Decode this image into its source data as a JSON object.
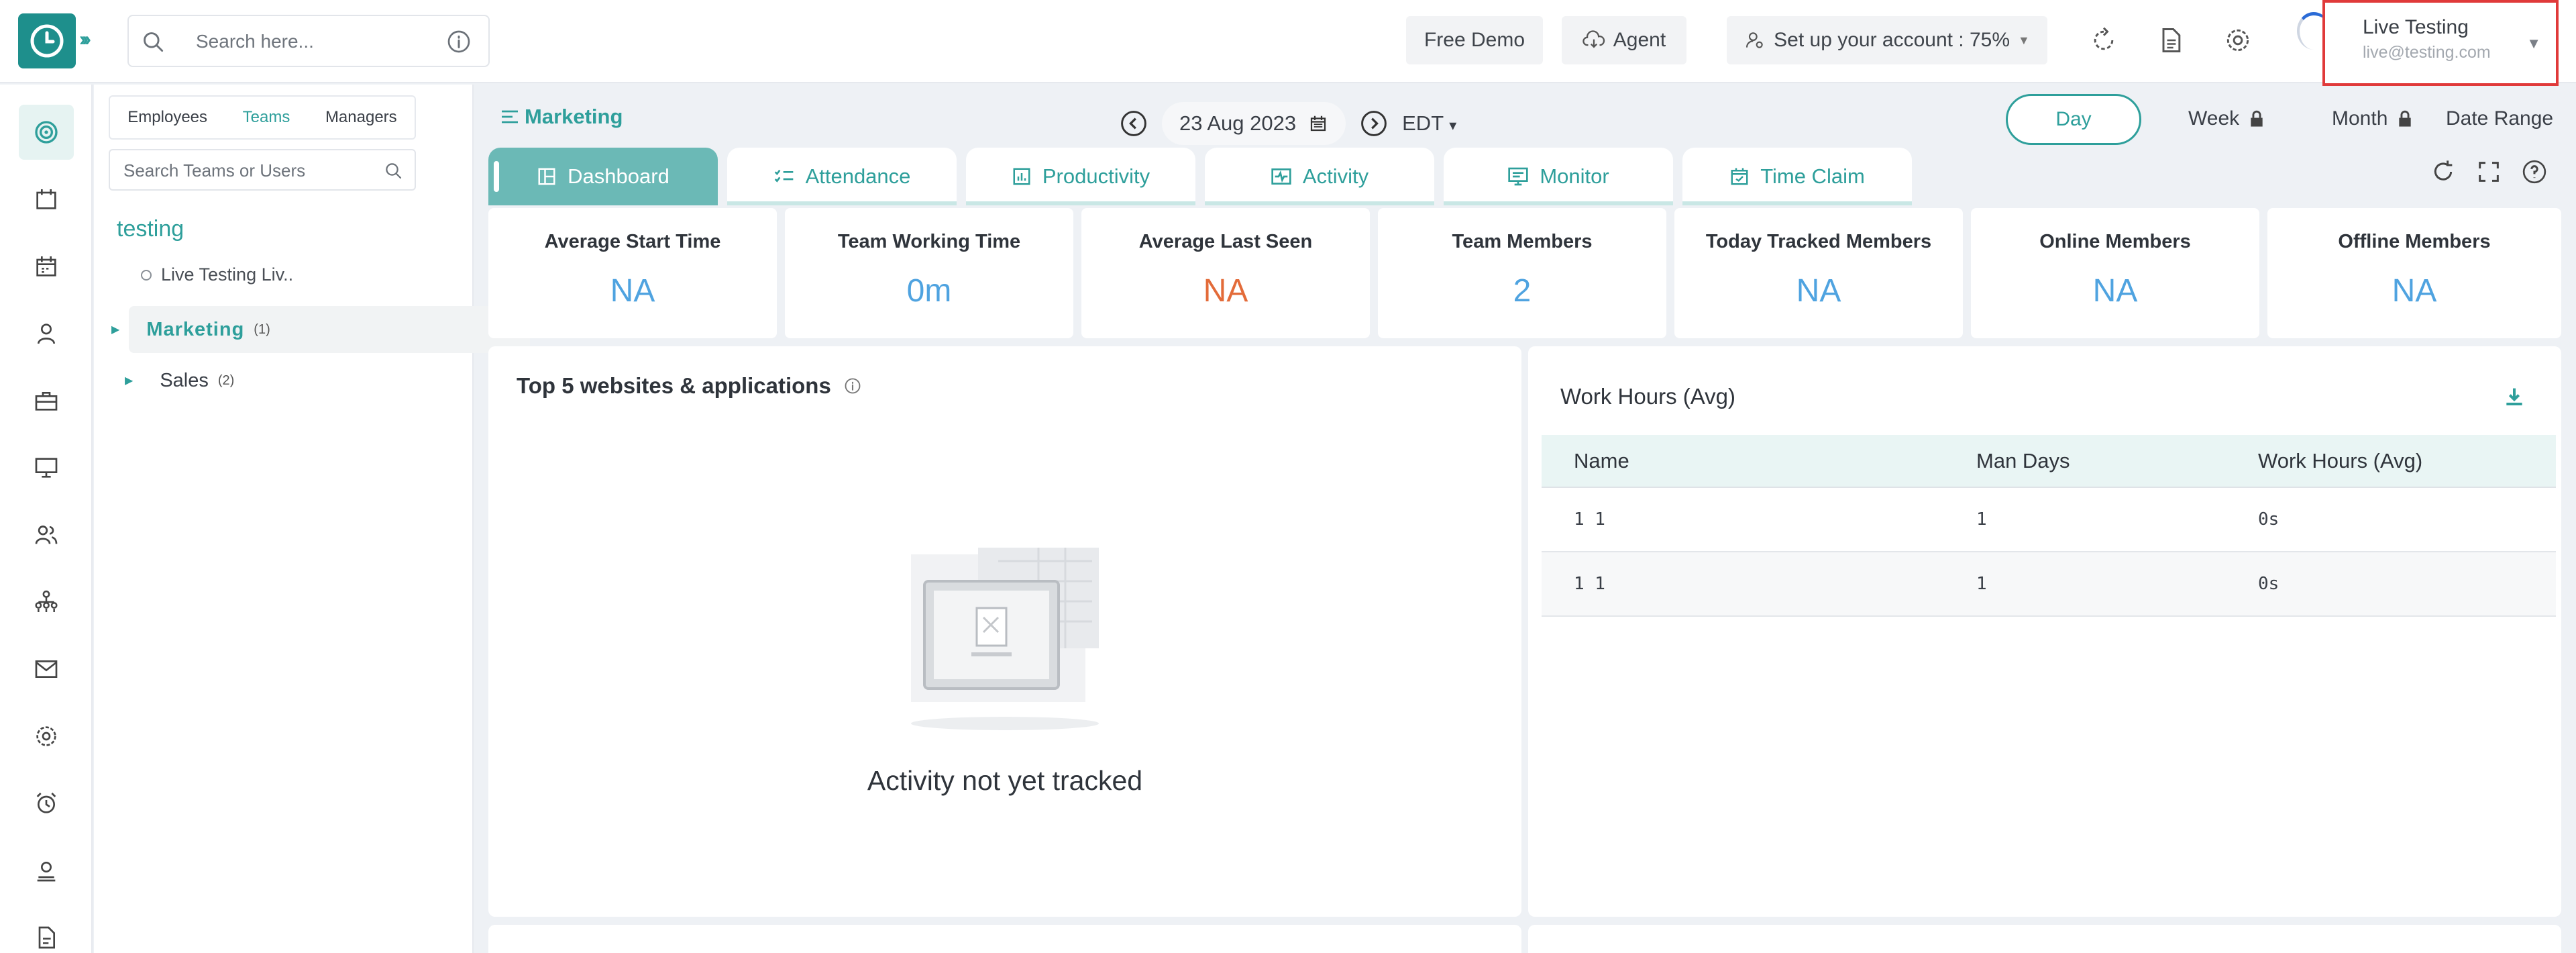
{
  "header": {
    "search_placeholder": "Search here...",
    "free_demo_label": "Free Demo",
    "agent_label": "Agent",
    "setup_label": "Set up your account : 75%",
    "user": {
      "name": "Live Testing",
      "email": "live@testing.com"
    }
  },
  "teams_panel": {
    "tabs": [
      "Employees",
      "Teams",
      "Managers"
    ],
    "active_tab": "Teams",
    "search_placeholder": "Search Teams or Users",
    "root": "testing",
    "user_item": "Live Testing Liv..",
    "groups": [
      {
        "label": "Marketing",
        "count": "(1)",
        "active": true
      },
      {
        "label": "Sales",
        "count": "(2)",
        "active": false
      }
    ]
  },
  "toolbar": {
    "breadcrumb": "Marketing",
    "date": "23 Aug 2023",
    "timezone": "EDT",
    "ranges": [
      "Day",
      "Week",
      "Month",
      "Date Range"
    ]
  },
  "tabs": [
    "Dashboard",
    "Attendance",
    "Productivity",
    "Activity",
    "Monitor",
    "Time Claim"
  ],
  "stats": [
    {
      "label": "Average Start Time",
      "value": "NA"
    },
    {
      "label": "Team Working Time",
      "value": "0m"
    },
    {
      "label": "Average Last Seen",
      "value": "NA"
    },
    {
      "label": "Team Members",
      "value": "2"
    },
    {
      "label": "Today Tracked Members",
      "value": "NA"
    },
    {
      "label": "Online Members",
      "value": "NA"
    },
    {
      "label": "Offline Members",
      "value": "NA"
    }
  ],
  "websites_panel": {
    "title": "Top 5 websites & applications",
    "empty_text": "Activity not yet tracked"
  },
  "work_hours": {
    "title": "Work Hours (Avg)",
    "columns": [
      "Name",
      "Man Days",
      "Work Hours (Avg)"
    ],
    "rows": [
      [
        "1 1",
        "1",
        "0s"
      ],
      [
        "1 1",
        "1",
        "0s"
      ]
    ]
  },
  "colors": {
    "accent": "#2e9f9b",
    "value_blue": "#4fa3e0",
    "value_red": "#e36b39",
    "highlight_border": "#e03a3a"
  }
}
